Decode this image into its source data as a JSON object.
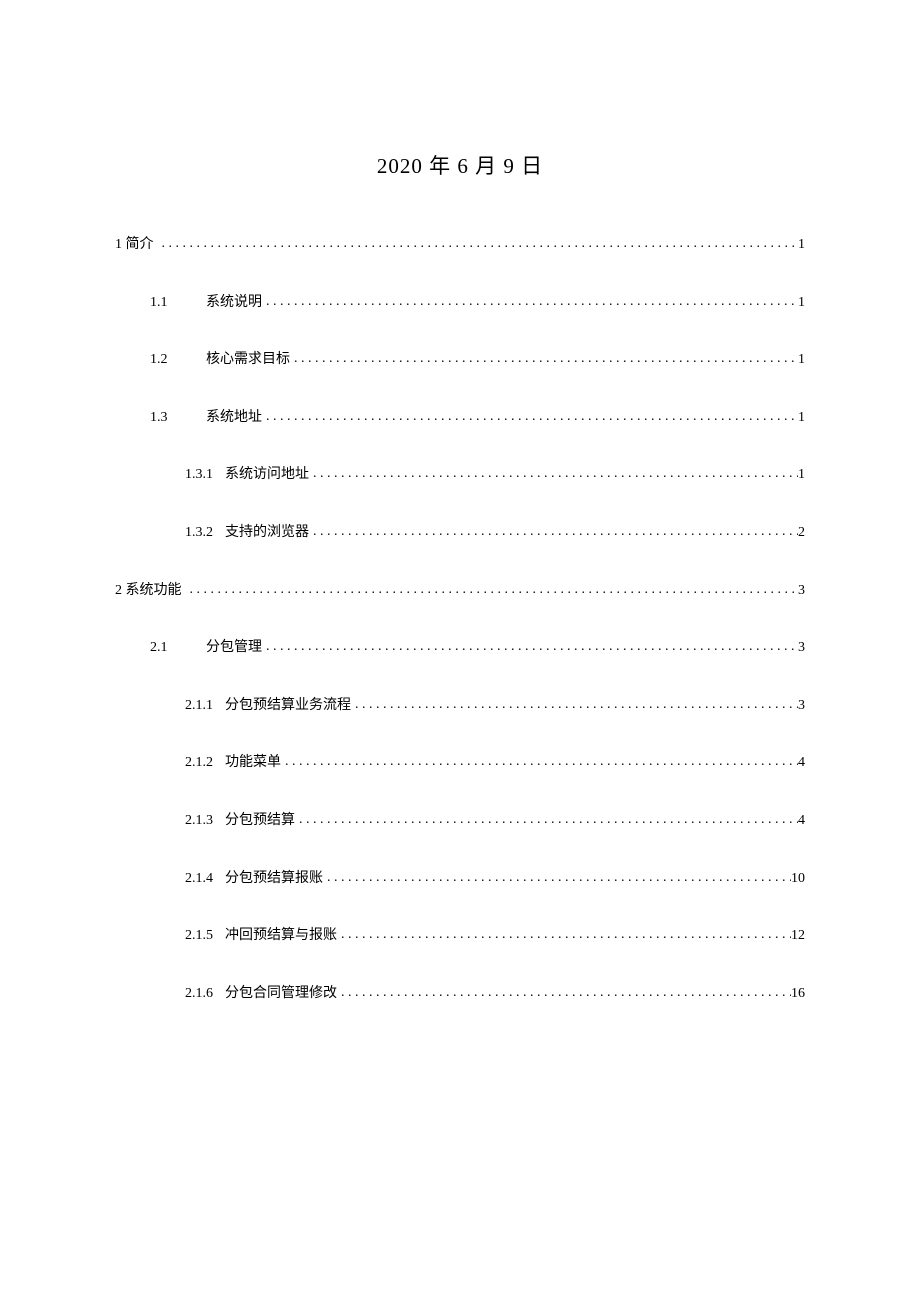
{
  "date": "2020 年 6 月 9 日",
  "toc": [
    {
      "level": 1,
      "num": "1",
      "title": "简介",
      "page": "1"
    },
    {
      "level": 2,
      "num": "1.1",
      "title": "系统说明",
      "page": "1"
    },
    {
      "level": 2,
      "num": "1.2",
      "title": "核心需求目标",
      "page": "1"
    },
    {
      "level": 2,
      "num": "1.3",
      "title": "系统地址",
      "page": "1"
    },
    {
      "level": 3,
      "num": "1.3.1",
      "title": "系统访问地址",
      "page": "1"
    },
    {
      "level": 3,
      "num": "1.3.2",
      "title": "支持的浏览器",
      "page": "2"
    },
    {
      "level": 1,
      "num": "2",
      "title": "系统功能",
      "page": "3"
    },
    {
      "level": 2,
      "num": "2.1",
      "title": "分包管理",
      "page": "3"
    },
    {
      "level": 3,
      "num": "2.1.1",
      "title": "分包预结算业务流程",
      "page": "3"
    },
    {
      "level": 3,
      "num": "2.1.2",
      "title": "功能菜单",
      "page": "4"
    },
    {
      "level": 3,
      "num": "2.1.3",
      "title": "分包预结算",
      "page": "4"
    },
    {
      "level": 3,
      "num": "2.1.4",
      "title": "分包预结算报账",
      "page": "10"
    },
    {
      "level": 3,
      "num": "2.1.5",
      "title": "冲回预结算与报账",
      "page": "12"
    },
    {
      "level": 3,
      "num": "2.1.6",
      "title": "分包合同管理修改",
      "page": "16"
    }
  ]
}
